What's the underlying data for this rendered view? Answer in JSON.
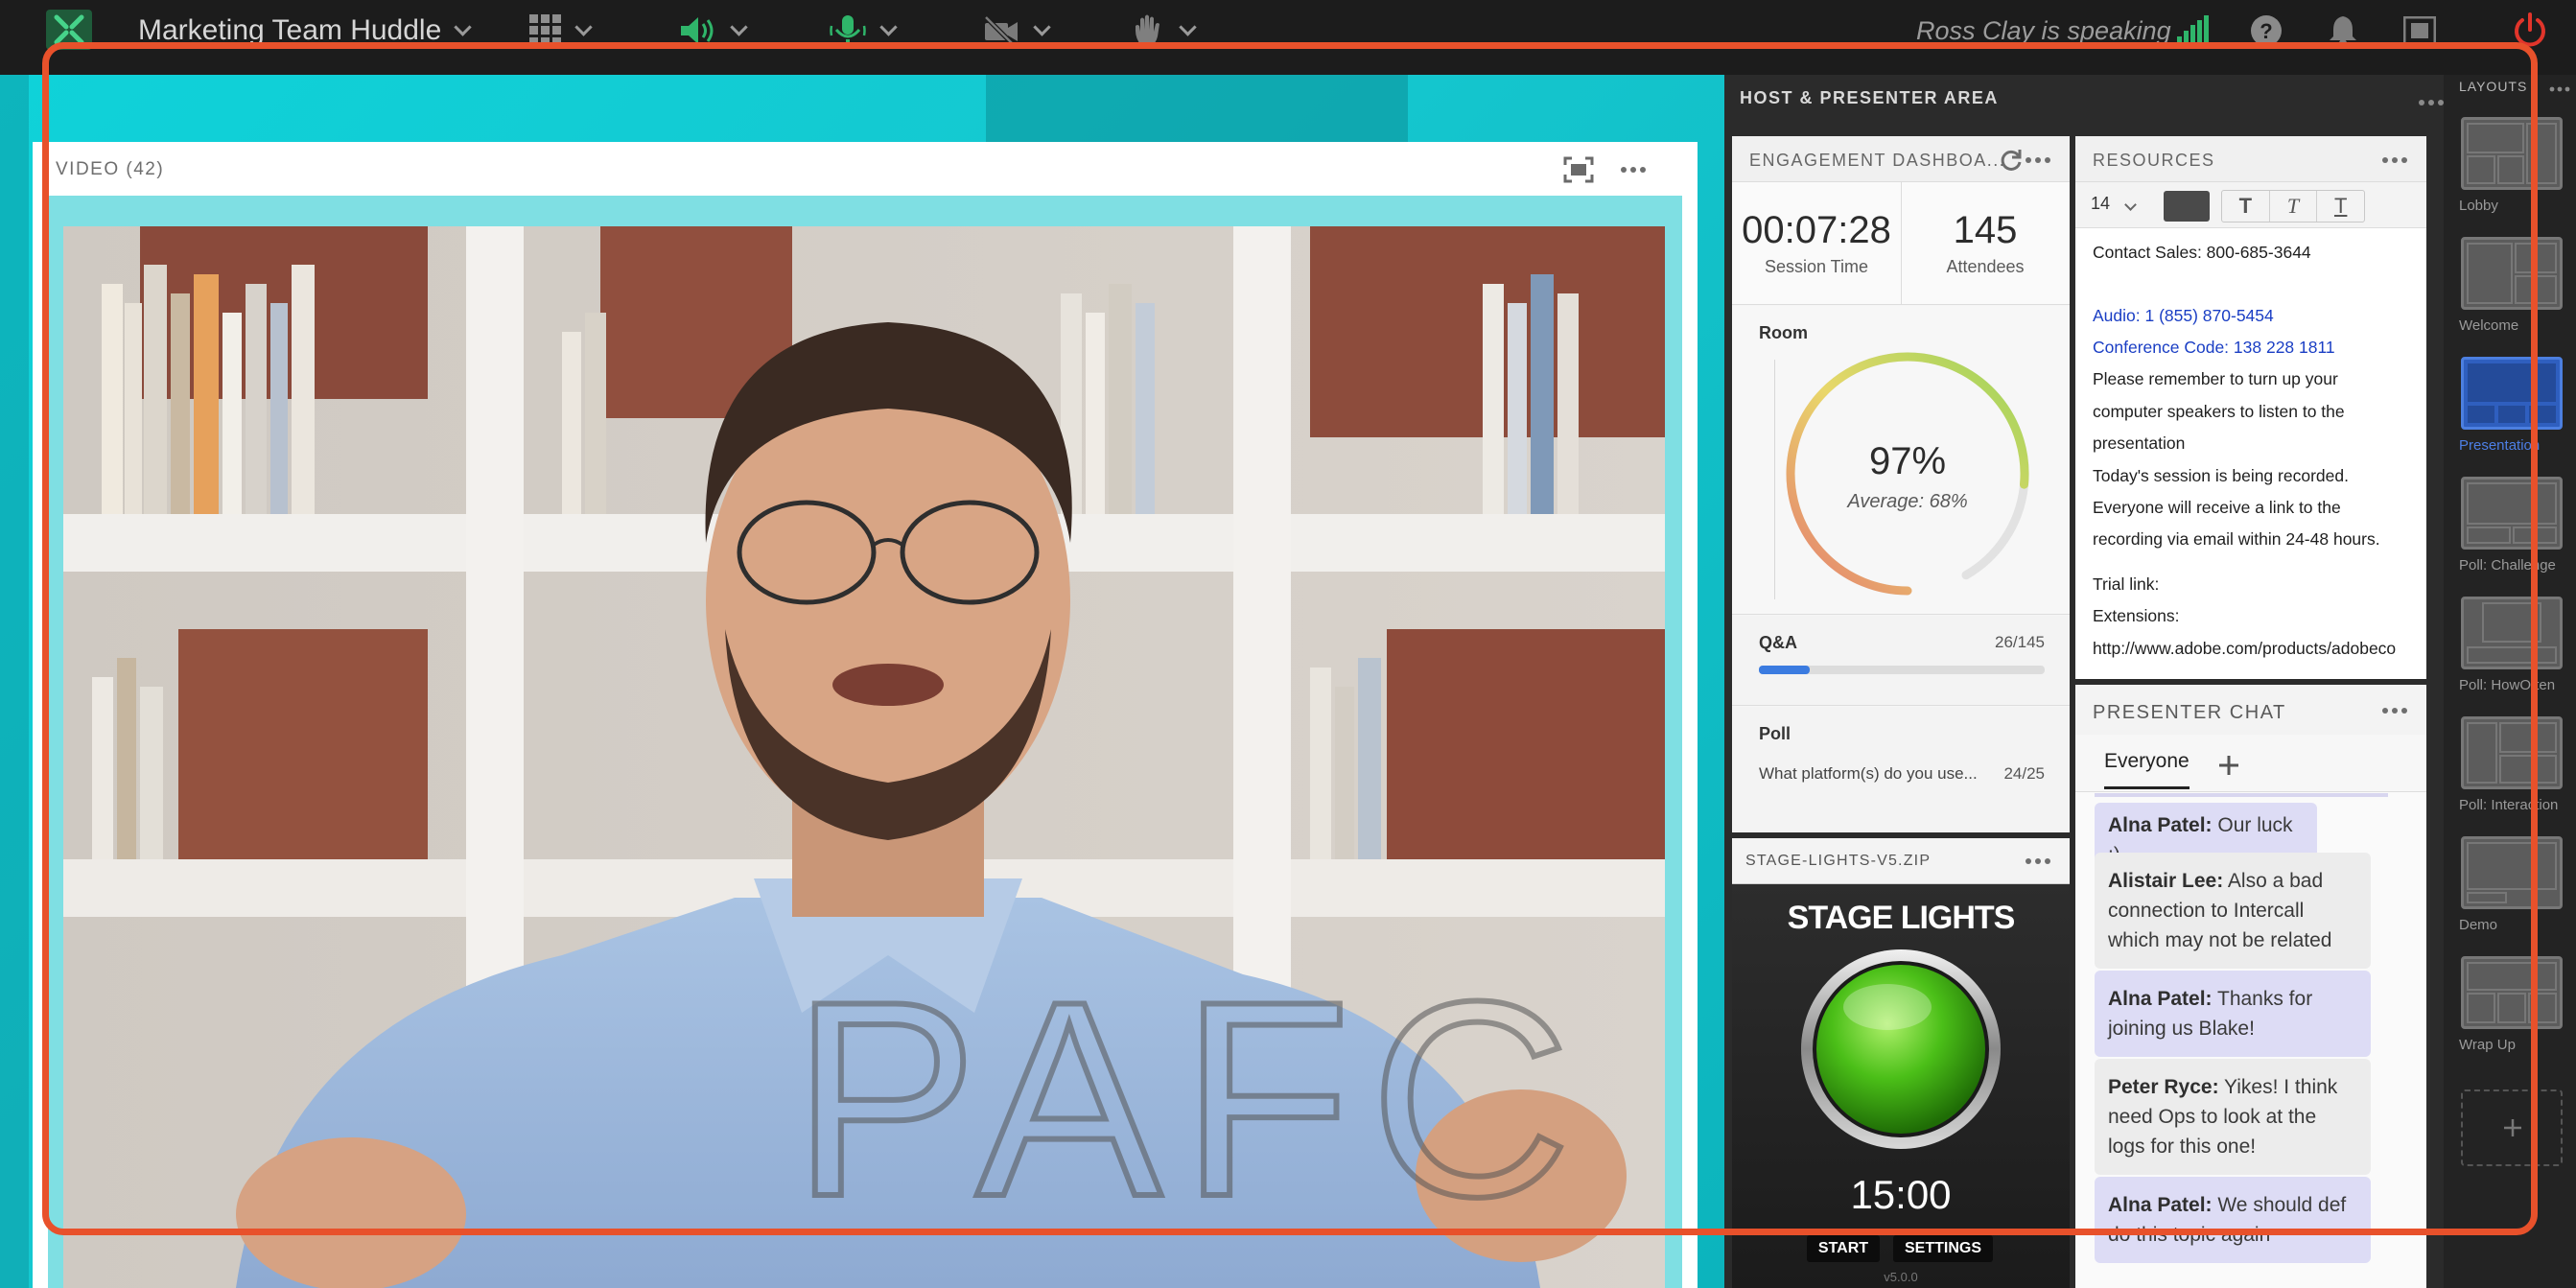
{
  "topbar": {
    "title": "Marketing Team Huddle",
    "speaking": "Ross Clay is speaking"
  },
  "video": {
    "title": "VIDEO (42)",
    "watermark": "PAFC"
  },
  "host_area": {
    "title": "HOST & PRESENTER AREA"
  },
  "engagement": {
    "title": "ENGAGEMENT DASHBOA...",
    "session_time": "00:07:28",
    "session_time_label": "Session Time",
    "attendees": "145",
    "attendees_label": "Attendees",
    "room_label": "Room",
    "room_percent": "97%",
    "room_fraction": 0.97,
    "average": "Average: 68%",
    "qa_label": "Q&A",
    "qa_count": "26/145",
    "qa_fraction": 0.179,
    "poll_label": "Poll",
    "poll_question": "What platform(s) do you use...",
    "poll_count": "24/25"
  },
  "resources": {
    "title": "RESOURCES",
    "font_size": "14",
    "lines": [
      "Contact Sales: 800-685-3644",
      "Audio: 1 (855) 870-5454",
      "Conference Code: 138 228 1811",
      "Please remember to turn up your",
      "computer speakers to listen to the",
      "presentation",
      "Today's session is being recorded.",
      "Everyone will receive a link to the",
      "recording via email within 24-48 hours.",
      "Trial link:",
      "Extensions:",
      "http://www.adobe.com/products/adobeco"
    ]
  },
  "stage": {
    "file_title": "STAGE-LIGHTS-V5.ZIP",
    "heading": "STAGE LIGHTS",
    "timer": "15:00",
    "start": "START",
    "settings": "SETTINGS",
    "version": "v5.0.0"
  },
  "chat": {
    "title": "PRESENTER CHAT",
    "tab": "Everyone",
    "messages": [
      {
        "author": "Alna Patel:",
        "text": " Our luck :)"
      },
      {
        "author": "Alistair Lee:",
        "text": " Also a bad connection to Intercall which may not be related"
      },
      {
        "author": "Alna Patel:",
        "text": " Thanks for joining us Blake!"
      },
      {
        "author": "Peter Ryce:",
        "text": " Yikes! I think need Ops to look at the logs for this one!"
      },
      {
        "author": "Alna Patel:",
        "text": " We should def do this topic again"
      }
    ]
  },
  "layouts": {
    "title": "LAYOUTS",
    "items": [
      "Lobby",
      "Welcome",
      "Presentation",
      "Poll: Challenge",
      "Poll: HowOften",
      "Poll: Interaction",
      "Demo",
      "Wrap Up"
    ],
    "active": "Presentation"
  },
  "colors": {
    "accent_orange": "#e8512b",
    "teal": "#12cad2",
    "active_blue": "#3d6fd6",
    "gauge_green": "#9ad45a"
  }
}
